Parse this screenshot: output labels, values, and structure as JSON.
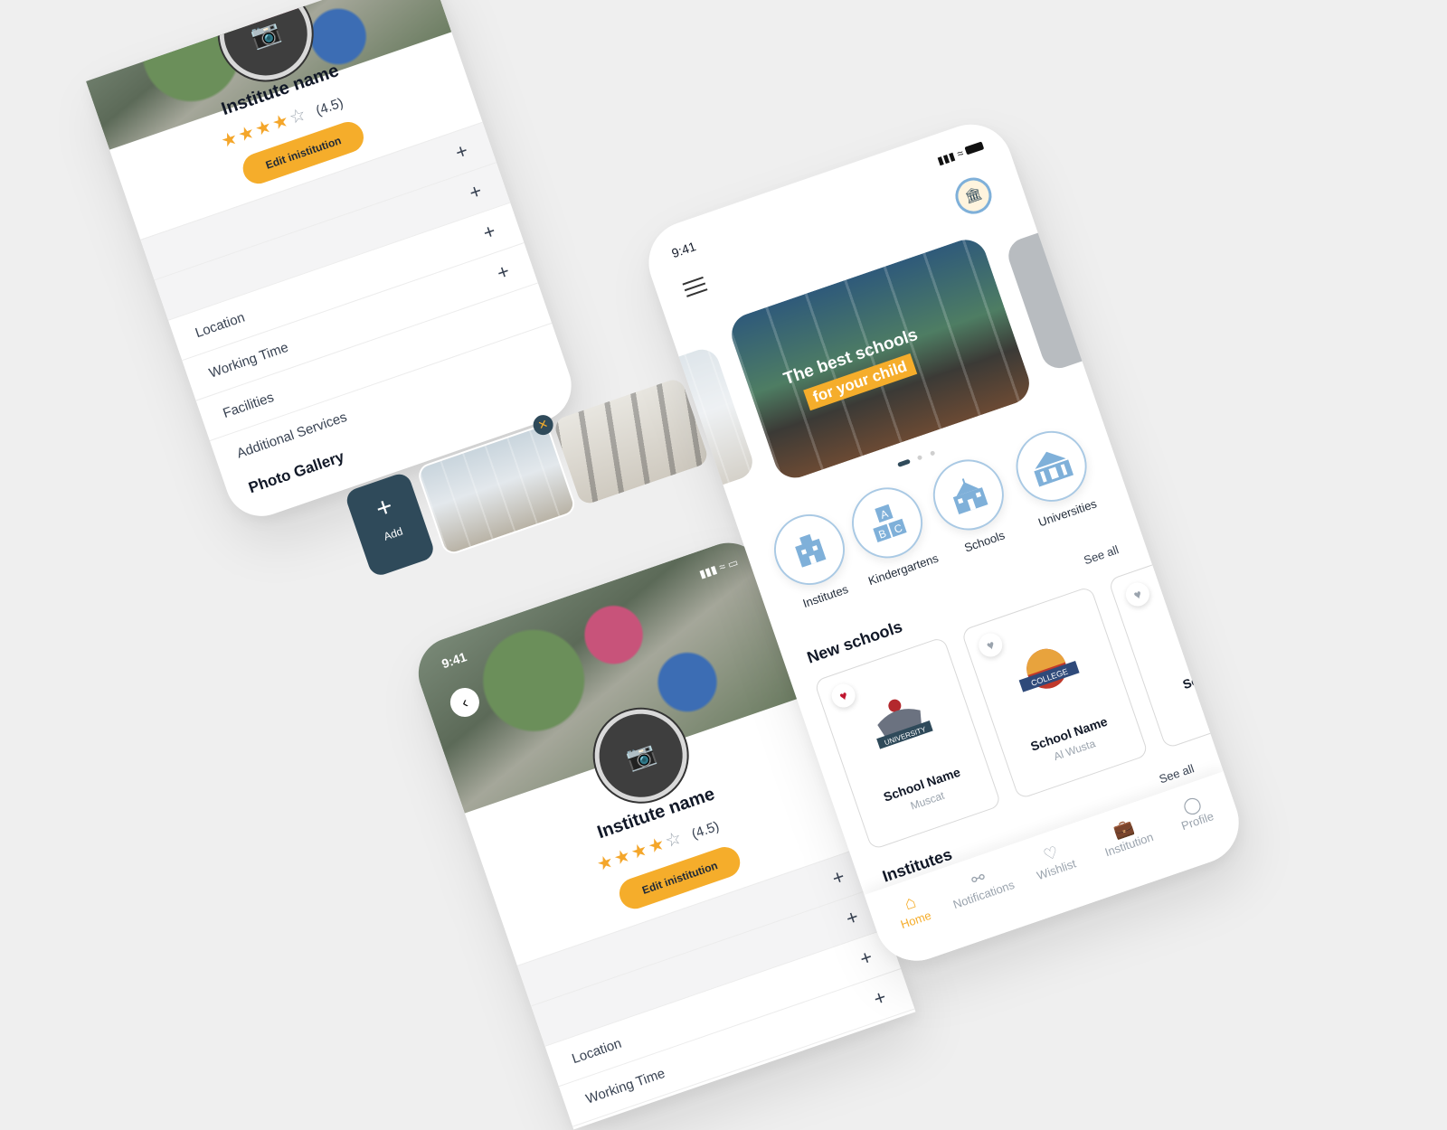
{
  "status": {
    "time": "9:41"
  },
  "detail": {
    "institute_name": "Institute name",
    "rating_text": "(4.5)",
    "rating": 4,
    "rating_max": 5,
    "edit_button": "Edit inistitution",
    "sections": [
      "Location",
      "Working Time",
      "Facilities",
      "Additional Services"
    ],
    "gallery_title": "Photo Gallery",
    "add_label": "Add",
    "badge_text": "UNIVERSITY"
  },
  "home": {
    "banner_line1": "The best schools",
    "banner_line2": "for your child",
    "categories": [
      "Institutes",
      "Kindergartens",
      "Schools",
      "Universities"
    ],
    "see_all": "See all",
    "new_schools_title": "New schools",
    "schools": [
      {
        "name": "School Name",
        "city": "Muscat",
        "logo": "UNIVERSITY",
        "favorite": true
      },
      {
        "name": "School Name",
        "city": "Al Wusta",
        "logo": "COLLEGE",
        "favorite": false
      },
      {
        "name": "Sch",
        "city": "",
        "logo": "",
        "favorite": false
      }
    ],
    "institutes_title": "Institutes",
    "nav": [
      "Home",
      "Notifications",
      "Wishlist",
      "Institution",
      "Profile"
    ],
    "active_nav": "Home"
  },
  "colors": {
    "accent": "#f5ad2b",
    "dark_teal": "#2f4a5a",
    "heart_red": "#c0152f",
    "category_blue": "#7fb0d9"
  }
}
